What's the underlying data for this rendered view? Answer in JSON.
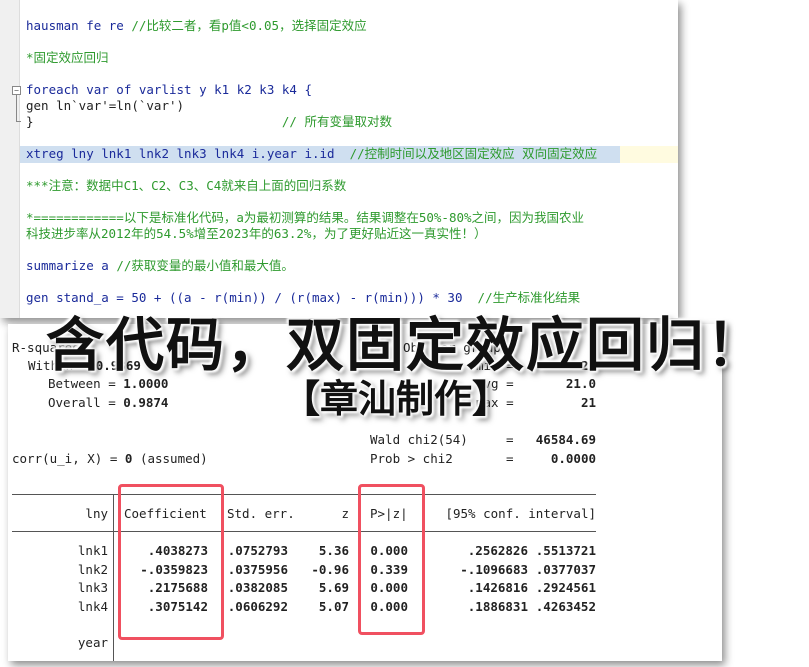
{
  "editor": {
    "lines": [
      {
        "code": "hausman fe re ",
        "comment": "//比较二者，看p值<0.05，选择固定效应"
      },
      {
        "code": "",
        "comment": "*固定效应回归"
      },
      {
        "code": "foreach var of varlist y k1 k2 k3 k4 {",
        "comment": ""
      },
      {
        "code": "gen ln`var'=ln(`var')",
        "comment": ""
      },
      {
        "code": "}                                 ",
        "comment": "// 所有变量取对数"
      },
      {
        "code": "xtreg lny lnk1 lnk2 lnk3 lnk4 i.year i.id  ",
        "comment": "//控制时间以及地区固定效应 双向固定效应"
      },
      {
        "code": "",
        "comment": "***注意：数据中C1、C2、C3、C4就来自上面的回归系数"
      },
      {
        "code": "",
        "comment": "*============以下是标准化代码，a为最初测算的结果。结果调整在50%-80%之间，因为我国农业"
      },
      {
        "code": "",
        "comment": "科技进步率从2012年的54.5%增至2023年的63.2%，为了更好贴近这一真实性！）"
      },
      {
        "code": "summarize a ",
        "comment": "//获取变量的最小值和最大值。"
      },
      {
        "code": "gen stand_a = 50 + ((a - r(min)) / (r(max) - r(min))) * 30  ",
        "comment": "//生产标准化结果"
      }
    ]
  },
  "output": {
    "rsq_label": "R-squared:",
    "within": {
      "label": "Within",
      "value": "0.9369"
    },
    "between": {
      "label": "Between",
      "value": "1.0000"
    },
    "overall": {
      "label": "Overall",
      "value": "0.9874"
    },
    "obs_label": "Obs per group:",
    "obs_min": {
      "label": "min =",
      "value": "21"
    },
    "obs_avg": {
      "label": "avg =",
      "value": "21.0"
    },
    "obs_max": {
      "label": "max =",
      "value": "21"
    },
    "wald": {
      "label": "Wald chi2(54)",
      "eq": "=",
      "value": "46584.69"
    },
    "prob": {
      "label": "Prob > chi2",
      "eq": "=",
      "value": "0.0000"
    },
    "corr": {
      "label": "corr(u_i, X) = ",
      "value": "0",
      "note": " (assumed)"
    },
    "table": {
      "headers": [
        "lny",
        "Coefficient",
        "Std. err.",
        "z",
        "P>|z|",
        "[95% conf. interval]"
      ],
      "rows": [
        [
          "lnk1",
          ".4038273",
          ".0752793",
          "5.36",
          "0.000",
          ".2562826",
          ".5513721"
        ],
        [
          "lnk2",
          "-.0359823",
          ".0375956",
          "-0.96",
          "0.339",
          "-.1096683",
          ".0377037"
        ],
        [
          "lnk3",
          ".2175688",
          ".0382085",
          "5.69",
          "0.000",
          ".1426816",
          ".2924561"
        ],
        [
          "lnk4",
          ".3075142",
          ".0606292",
          "5.07",
          "0.000",
          ".1886831",
          ".4263452"
        ]
      ],
      "group_label": "year"
    }
  },
  "overlay": {
    "title": "含代码，双固定效应回归！",
    "author": "【章汕制作】"
  },
  "colors": {
    "highlight_box": "#f05060",
    "keyword": "#1a2a9a",
    "comment": "#2e9a2e",
    "selection": "#cfdff0"
  }
}
